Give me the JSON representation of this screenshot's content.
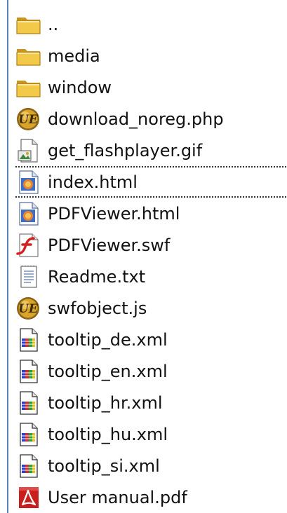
{
  "explorer": {
    "files": [
      {
        "name": "..",
        "icon": "folder-icon"
      },
      {
        "name": "media",
        "icon": "folder-icon"
      },
      {
        "name": "window",
        "icon": "folder-icon"
      },
      {
        "name": "download_noreg.php",
        "icon": "ultraedit-icon"
      },
      {
        "name": "get_flashplayer.gif",
        "icon": "image-file-icon"
      },
      {
        "name": "index.html",
        "icon": "html-file-icon",
        "focused": true
      },
      {
        "name": "PDFViewer.html",
        "icon": "html-file-icon"
      },
      {
        "name": "PDFViewer.swf",
        "icon": "flash-icon"
      },
      {
        "name": "Readme.txt",
        "icon": "text-file-icon"
      },
      {
        "name": "swfobject.js",
        "icon": "ultraedit-icon"
      },
      {
        "name": "tooltip_de.xml",
        "icon": "xml-file-icon"
      },
      {
        "name": "tooltip_en.xml",
        "icon": "xml-file-icon"
      },
      {
        "name": "tooltip_hr.xml",
        "icon": "xml-file-icon"
      },
      {
        "name": "tooltip_hu.xml",
        "icon": "xml-file-icon"
      },
      {
        "name": "tooltip_si.xml",
        "icon": "xml-file-icon"
      },
      {
        "name": "User manual.pdf",
        "icon": "pdf-icon"
      }
    ]
  },
  "colors": {
    "folder": "#f3c94a",
    "folder_dark": "#c9951e",
    "border": "#5b7fb9",
    "focus": "#333333"
  }
}
